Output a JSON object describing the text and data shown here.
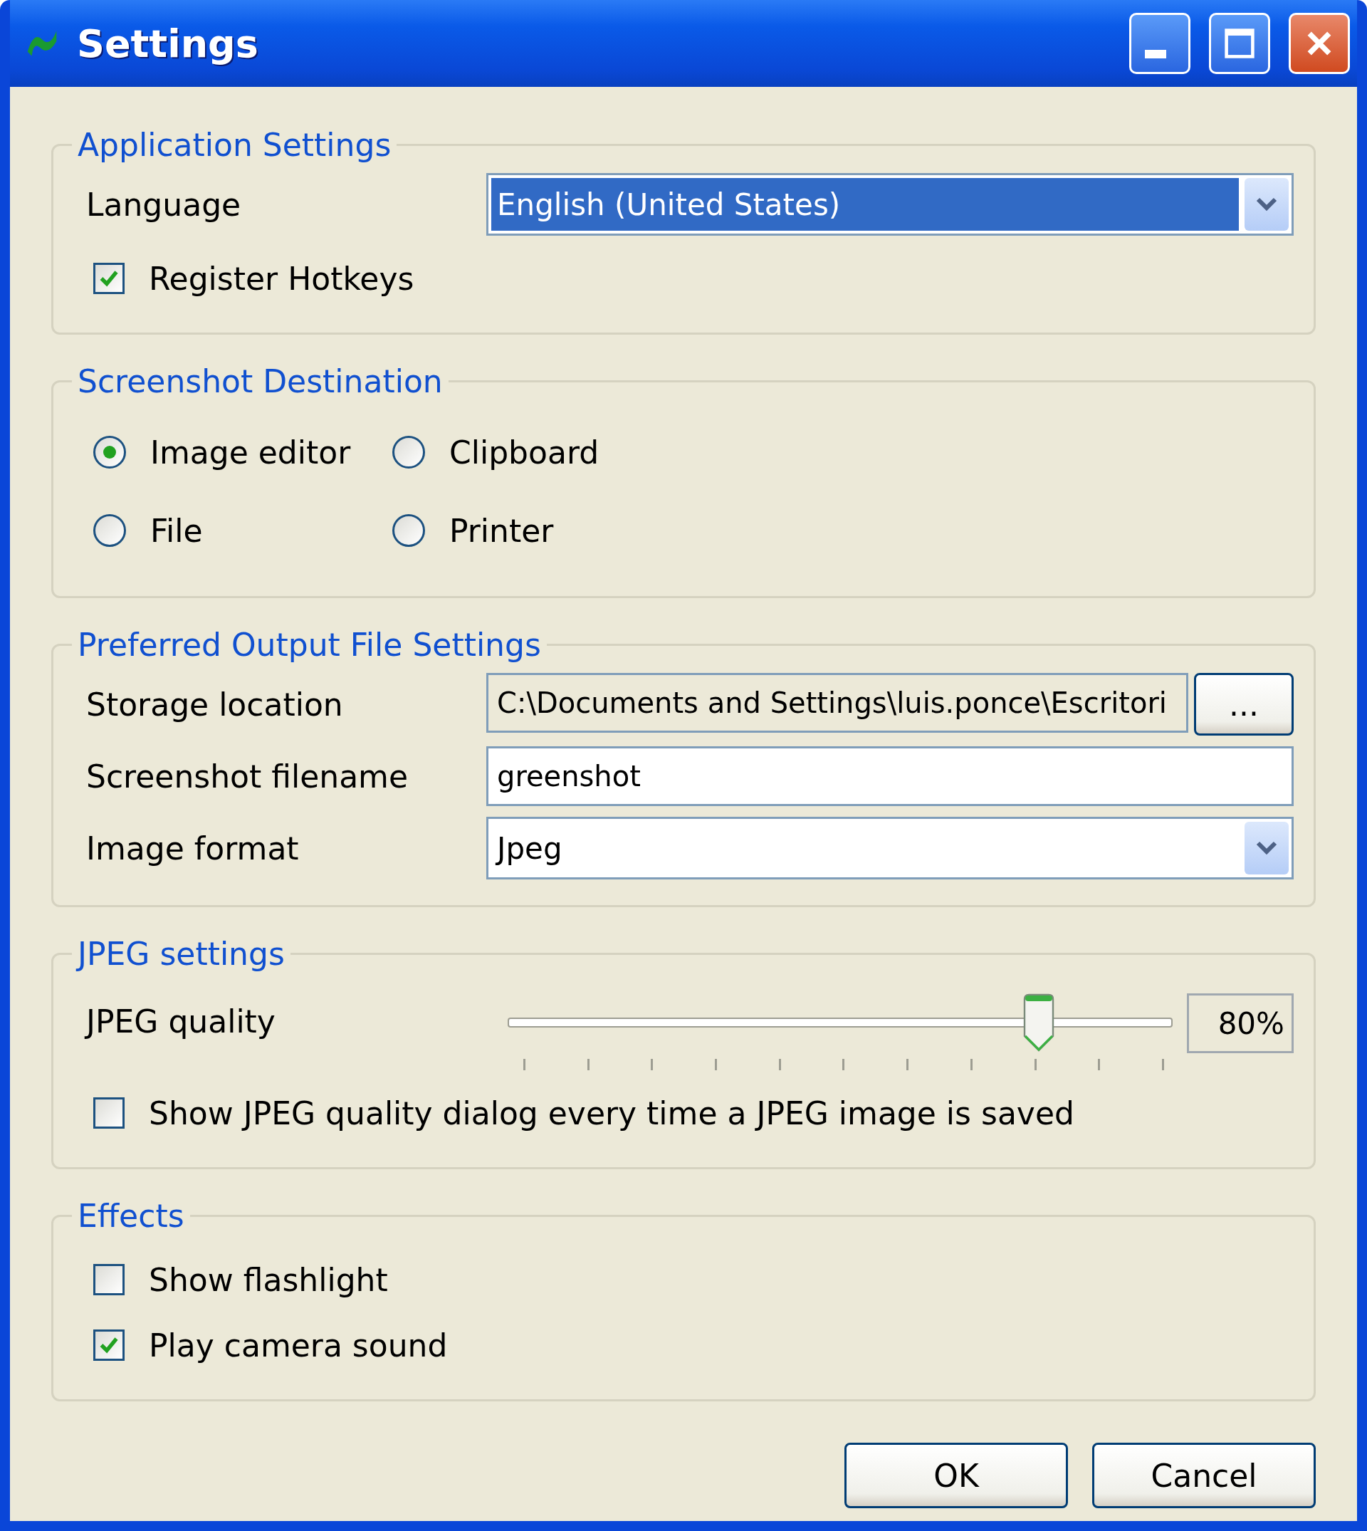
{
  "window": {
    "title": "Settings"
  },
  "application_settings": {
    "title": "Application Settings",
    "language": {
      "label": "Language",
      "value": "English (United States)",
      "focused": true
    },
    "register_hotkeys": {
      "label": "Register Hotkeys",
      "checked": true
    }
  },
  "screenshot_destination": {
    "title": "Screenshot Destination",
    "options": [
      {
        "label": "Image editor",
        "selected": true
      },
      {
        "label": "Clipboard",
        "selected": false
      },
      {
        "label": "File",
        "selected": false
      },
      {
        "label": "Printer",
        "selected": false
      }
    ]
  },
  "output_file_settings": {
    "title": "Preferred Output File Settings",
    "storage_location": {
      "label": "Storage location",
      "value": "C:\\Documents and Settings\\luis.ponce\\Escritori",
      "browse": "..."
    },
    "screenshot_filename": {
      "label": "Screenshot filename",
      "value": "greenshot"
    },
    "image_format": {
      "label": "Image format",
      "value": "Jpeg"
    }
  },
  "jpeg_settings": {
    "title": "JPEG settings",
    "quality": {
      "label": "JPEG quality",
      "level": 0.8,
      "reading": "80%"
    },
    "show_dialog": {
      "label": "Show JPEG quality dialog every time a JPEG image is saved",
      "checked": false
    }
  },
  "effects": {
    "title": "Effects",
    "options": [
      {
        "label": "Show flashlight",
        "checked": false
      },
      {
        "label": "Play camera sound",
        "checked": true
      }
    ]
  },
  "buttons": [
    "OK",
    "Cancel"
  ]
}
